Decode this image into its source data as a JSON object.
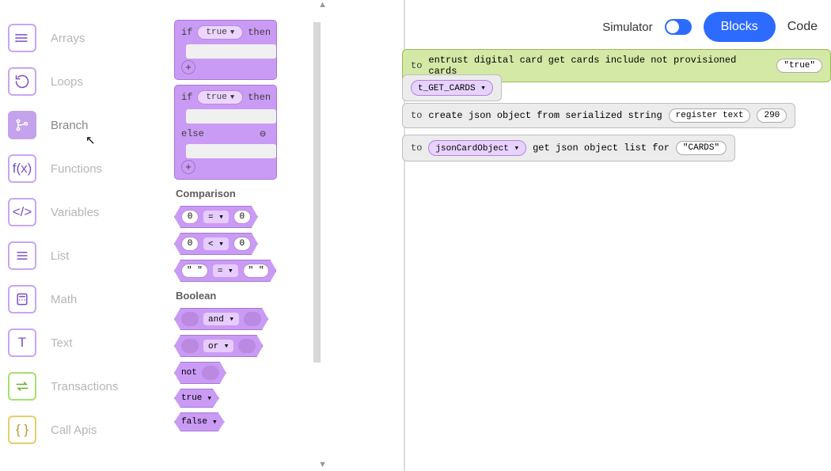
{
  "topbar": {
    "simulator_label": "Simulator",
    "blocks_btn": "Blocks",
    "code_btn": "Code"
  },
  "sidebar": {
    "items": [
      {
        "label": "Arrays",
        "icon": "list"
      },
      {
        "label": "Loops",
        "icon": "loop"
      },
      {
        "label": "Branch",
        "icon": "branch",
        "active": true
      },
      {
        "label": "Functions",
        "icon": "fx"
      },
      {
        "label": "Variables",
        "icon": "vars"
      },
      {
        "label": "List",
        "icon": "list"
      },
      {
        "label": "Math",
        "icon": "calc"
      },
      {
        "label": "Text",
        "icon": "text"
      },
      {
        "label": "Transactions",
        "icon": "txn"
      },
      {
        "label": "Call Apis",
        "icon": "api"
      }
    ]
  },
  "palette": {
    "if_label": "if",
    "then_label": "then",
    "else_label": "else",
    "true_dd": "true",
    "false_dd": "false",
    "section_comparison": "Comparison",
    "section_boolean": "Boolean",
    "cmp_zero": "0",
    "cmp_blank": "\" \"",
    "op_eq": "=",
    "op_lt": "<",
    "bool_and": "and",
    "bool_or": "or",
    "bool_not": "not"
  },
  "workspace": {
    "blocks": [
      {
        "to": "to",
        "body": "entrust digital card get cards include not provisioned cards",
        "tail_chip": "\"true\""
      },
      {
        "dd_chip": "t_GET_CARDS"
      },
      {
        "to": "to",
        "body": "create json object from serialized string",
        "mid_chip": "register text",
        "tail_chip": "290"
      },
      {
        "to": "to",
        "dd_chip": "jsonCardObject",
        "body": "get json object list for",
        "tail_chip": "\"CARDS\""
      }
    ]
  }
}
